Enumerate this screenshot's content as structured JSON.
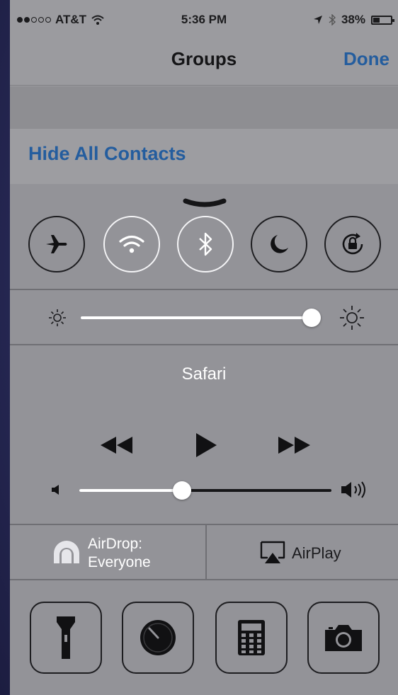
{
  "status_bar": {
    "carrier": "AT&T",
    "time": "5:36 PM",
    "battery_percent": "38%",
    "battery_level": 0.38,
    "signal_bars_filled": 2,
    "signal_bars_total": 5
  },
  "nav_bar": {
    "title": "Groups",
    "done_label": "Done"
  },
  "list": {
    "hide_all_label": "Hide All Contacts"
  },
  "control_center": {
    "toggles": [
      {
        "name": "airplane-mode",
        "icon": "airplane-icon",
        "on": false
      },
      {
        "name": "wifi",
        "icon": "wifi-icon",
        "on": true
      },
      {
        "name": "bluetooth",
        "icon": "bluetooth-icon",
        "on": true
      },
      {
        "name": "do-not-disturb",
        "icon": "moon-icon",
        "on": false
      },
      {
        "name": "rotation-lock",
        "icon": "rotation-lock-icon",
        "on": false
      }
    ],
    "brightness_level": 0.99,
    "now_playing_app": "Safari",
    "volume_level": 0.4,
    "airdrop_label": "AirDrop:",
    "airdrop_value": "Everyone",
    "airplay_label": "AirPlay",
    "tools": [
      "flashlight-icon",
      "timer-icon",
      "calculator-icon",
      "camera-icon"
    ]
  },
  "colors": {
    "link_blue": "#245d9e",
    "panel_gray": "#939398",
    "toggle_on": "#f4f4f6"
  }
}
